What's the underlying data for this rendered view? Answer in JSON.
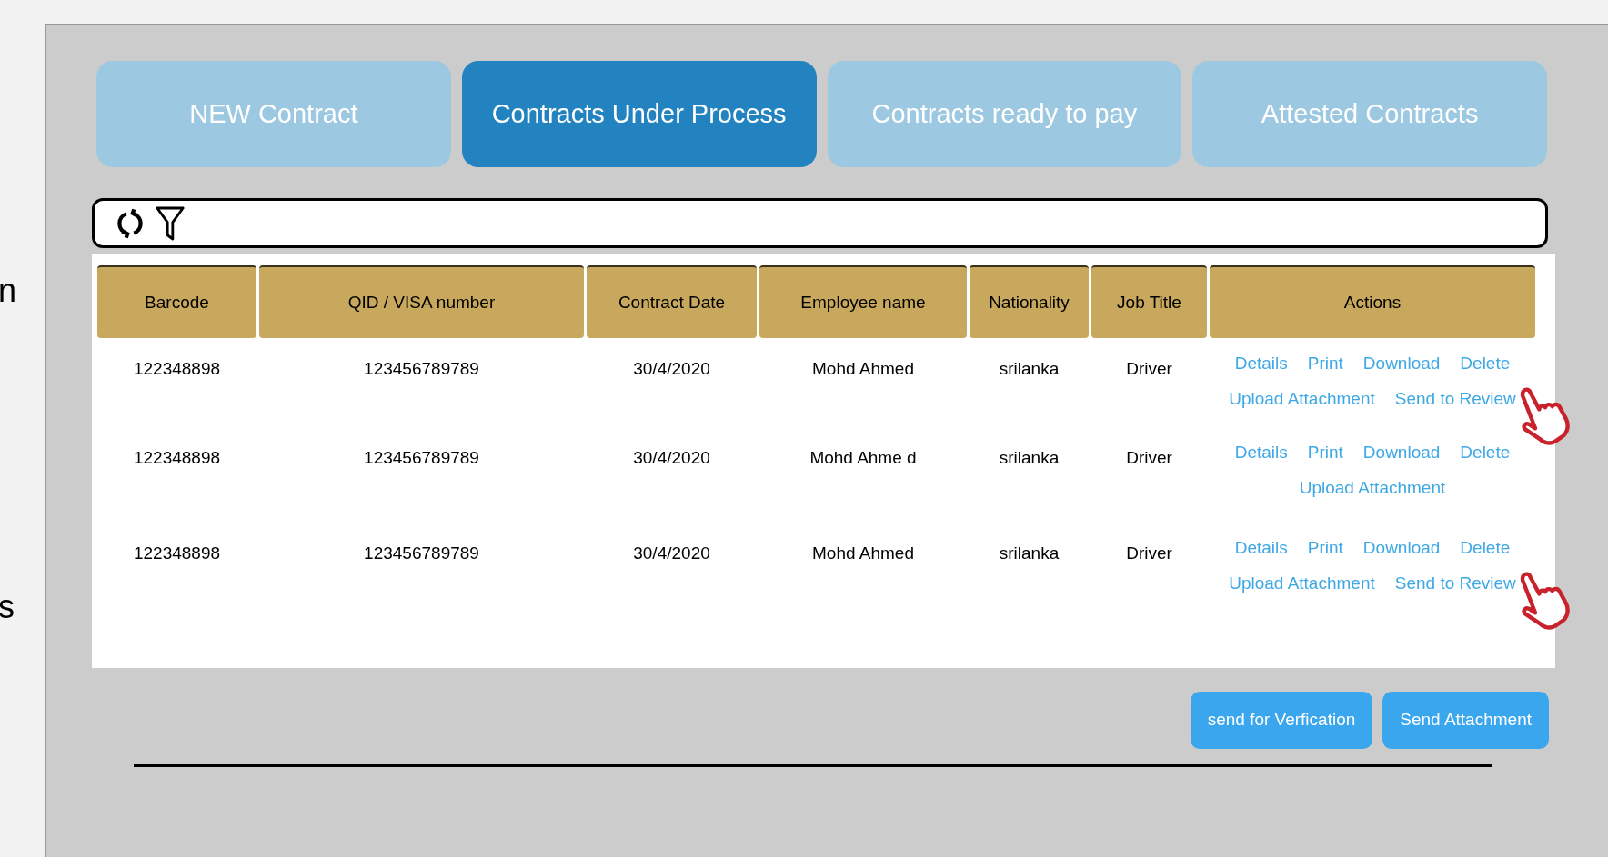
{
  "side_text": [
    "n",
    "s"
  ],
  "tabs": [
    {
      "label": "NEW Contract",
      "selected": false
    },
    {
      "label": "Contracts Under Process",
      "selected": true
    },
    {
      "label": "Contracts ready to pay",
      "selected": false
    },
    {
      "label": "Attested Contracts",
      "selected": false
    }
  ],
  "table": {
    "columns": [
      "Barcode",
      "QID  / VISA number",
      "Contract Date",
      "Employee name",
      "Nationality",
      "Job Title",
      "Actions"
    ],
    "rows": [
      {
        "cells": [
          "122348898",
          "123456789789",
          "30/4/2020",
          "Mohd Ahmed",
          "srilanka",
          "Driver"
        ],
        "actions": [
          "Details",
          "Print",
          "Download",
          "Delete",
          "Upload Attachment",
          "Send to Review"
        ],
        "pointer": true
      },
      {
        "cells": [
          "122348898",
          "123456789789",
          "30/4/2020",
          "Mohd Ahme d",
          "srilanka",
          "Driver"
        ],
        "actions": [
          "Details",
          "Print",
          "Download",
          "Delete",
          "Upload Attachment"
        ],
        "pointer": false
      },
      {
        "cells": [
          "122348898",
          "123456789789",
          "30/4/2020",
          "Mohd Ahmed",
          "srilanka",
          "Driver"
        ],
        "actions": [
          "Details",
          "Print",
          "Download",
          "Delete",
          "Upload Attachment",
          "Send to Review"
        ],
        "pointer": true
      }
    ]
  },
  "buttons": [
    "send for Verfication",
    "Send Attachment"
  ]
}
